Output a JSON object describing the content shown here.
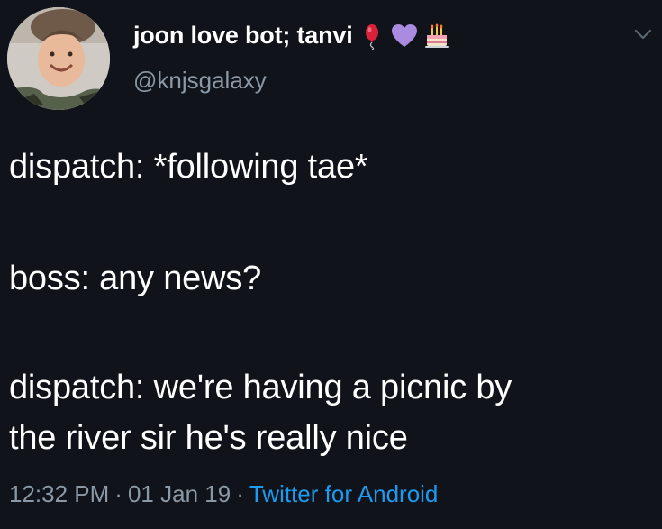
{
  "tweet": {
    "display_name": "joon love bot; tanvi",
    "handle": "@knjsgalaxy",
    "name_emojis": [
      "red-balloon-emoji",
      "purple-heart-emoji",
      "birthday-cake-emoji"
    ],
    "text_lines": [
      "dispatch: *following tae*",
      "boss: any news?",
      "dispatch: we're having a picnic by",
      "the river sir he's really nice"
    ],
    "time": "12:32 PM",
    "date": "01 Jan 19",
    "separator": "·",
    "source": "Twitter for Android"
  },
  "colors": {
    "background": "#101319",
    "text": "#ffffff",
    "muted": "#8b98a5",
    "link": "#1d9bf0"
  },
  "icons": {
    "menu": "chevron-down-icon",
    "avatar": "profile-photo"
  }
}
